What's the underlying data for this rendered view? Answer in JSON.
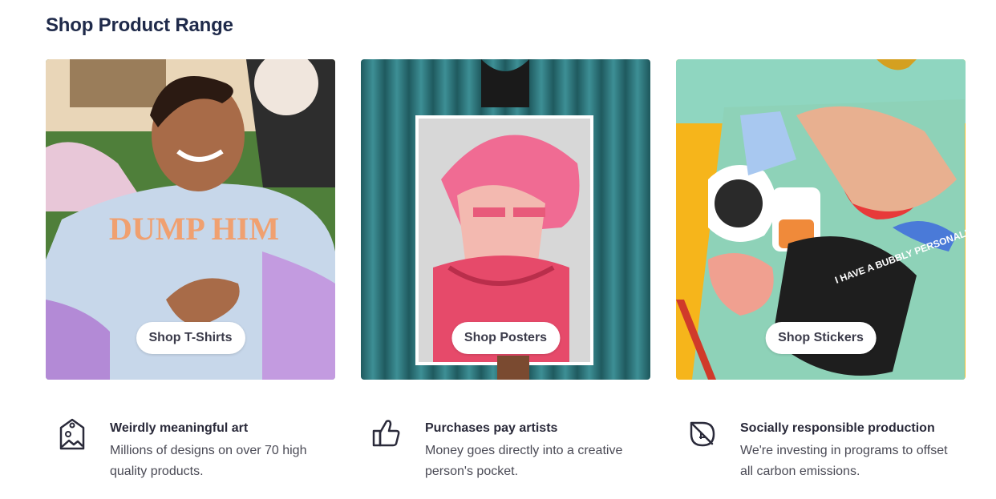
{
  "section": {
    "title": "Shop Product Range"
  },
  "cards": [
    {
      "button_label": "Shop T-Shirts",
      "image": "woman-in-dump-him-tshirt",
      "shirt_text": "DUMP HIM"
    },
    {
      "button_label": "Shop Posters",
      "image": "anime-poster-held-up"
    },
    {
      "button_label": "Shop Stickers",
      "image": "stickers-on-notebook",
      "sticker_text": "I HAVE A BUBBLY PERSONALITY"
    }
  ],
  "features": [
    {
      "icon": "image-tag-icon",
      "title": "Weirdly meaningful art",
      "description": "Millions of designs on over 70 high quality products."
    },
    {
      "icon": "thumbs-up-icon",
      "title": "Purchases pay artists",
      "description": "Money goes directly into a creative person's pocket."
    },
    {
      "icon": "leaf-icon",
      "title": "Socially responsible production",
      "description": "We're investing in programs to offset all carbon emissions."
    }
  ],
  "colors": {
    "title": "#1f2a4a",
    "text": "#4a4a55"
  }
}
